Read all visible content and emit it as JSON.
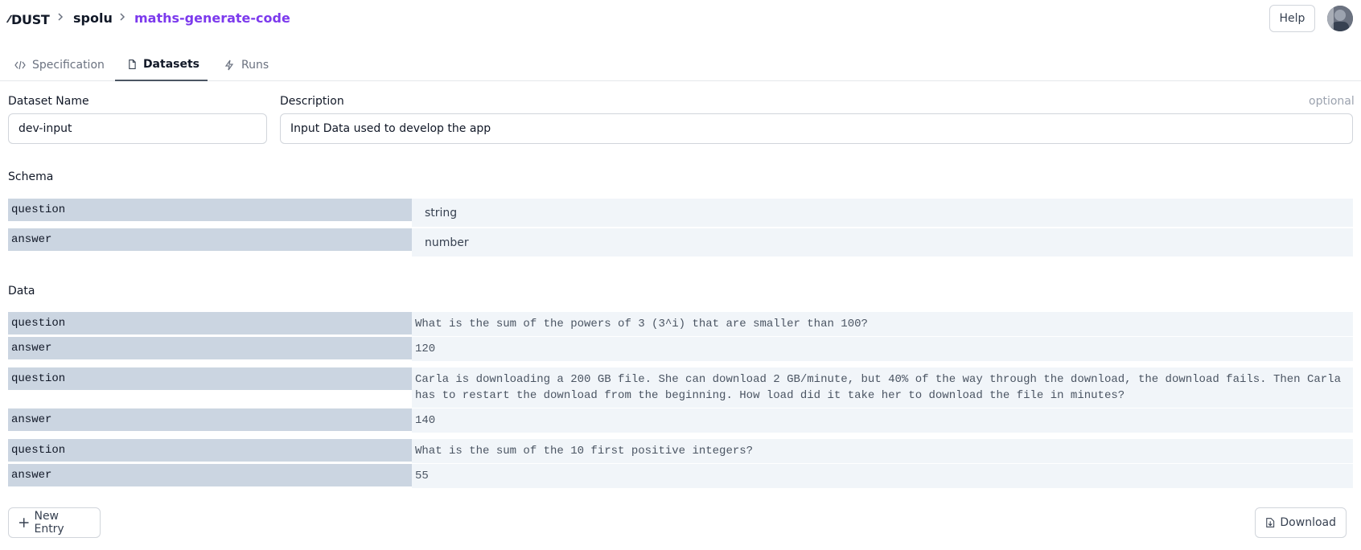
{
  "breadcrumb": {
    "logo": "DUST",
    "user": "spolu",
    "app": "maths-generate-code"
  },
  "header": {
    "help_label": "Help"
  },
  "tabs": [
    {
      "label": "Specification",
      "icon": "code-icon"
    },
    {
      "label": "Datasets",
      "icon": "document-icon"
    },
    {
      "label": "Runs",
      "icon": "bolt-icon"
    }
  ],
  "form": {
    "name_label": "Dataset Name",
    "name_value": "dev-input",
    "description_label": "Description",
    "description_optional": "optional",
    "description_value": "Input Data used to develop the app"
  },
  "schema": {
    "title": "Schema",
    "fields": [
      {
        "key": "question",
        "type": "string"
      },
      {
        "key": "answer",
        "type": "number"
      }
    ]
  },
  "data": {
    "title": "Data",
    "entries": [
      {
        "question": "What is the sum of the powers of 3 (3^i) that are smaller than 100?",
        "answer": "120"
      },
      {
        "question": "Carla is downloading a 200 GB file. She can download 2 GB/minute, but 40% of the way through the download, the download fails. Then Carla has to restart the download from the beginning. How load did it take her to download the file in minutes?",
        "answer": "140"
      },
      {
        "question": "What is the sum of the 10 first positive integers?",
        "answer": "55"
      }
    ],
    "question_key": "question",
    "answer_key": "answer"
  },
  "actions": {
    "new_entry_label": "New Entry",
    "download_label": "Download"
  },
  "colors": {
    "accent": "#7c3aed",
    "key_bg": "#cbd5e1",
    "value_bg": "#f1f5f9"
  }
}
